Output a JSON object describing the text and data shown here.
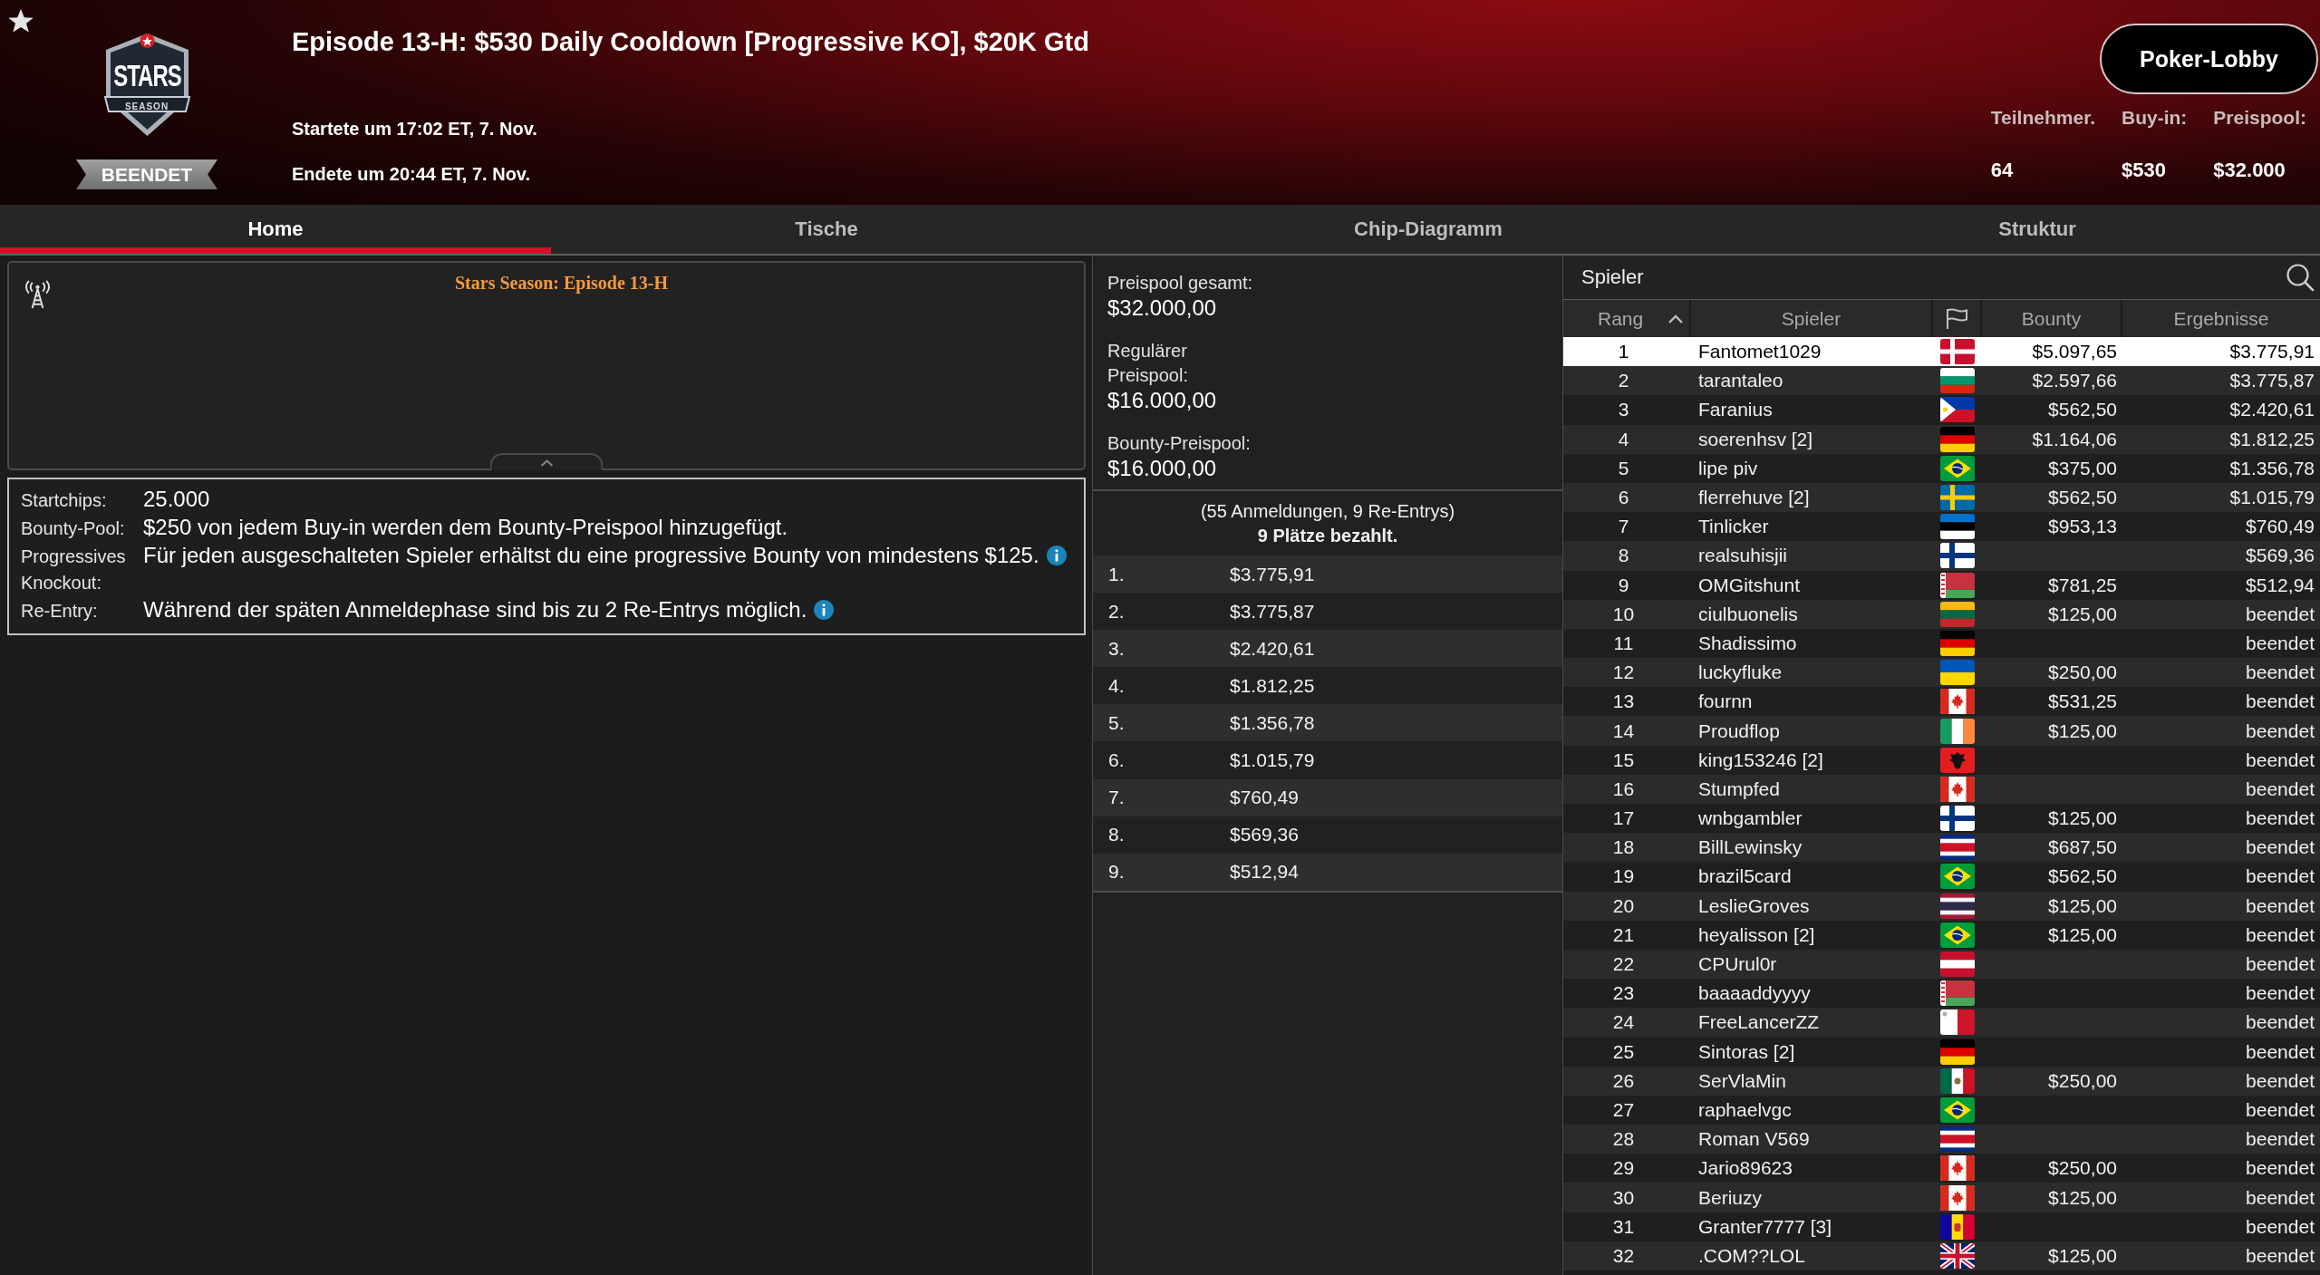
{
  "header": {
    "logo": {
      "title": "STARS",
      "subtitle": "SEASON"
    },
    "status": "BEENDET",
    "title": "Episode 13-H: $530 Daily Cooldown [Progressive KO], $20K Gtd",
    "started": "Startete um 17:02 ET, 7. Nov.",
    "ended": "Endete um 20:44 ET, 7. Nov.",
    "lobby_button": "Poker-Lobby",
    "stats": [
      {
        "label": "Teilnehmer.",
        "value": "64"
      },
      {
        "label": "Buy-in:",
        "value": "$530"
      },
      {
        "label": "Preispool:",
        "value": "$32.000"
      }
    ]
  },
  "tabs": [
    {
      "label": "Home",
      "selected": true
    },
    {
      "label": "Tische",
      "selected": false
    },
    {
      "label": "Chip-Diagramm",
      "selected": false
    },
    {
      "label": "Struktur",
      "selected": false
    }
  ],
  "news": {
    "title": "Stars Season: Episode 13-H"
  },
  "details": [
    {
      "label": "Startchips:",
      "value": "25.000",
      "info": false
    },
    {
      "label": "Bounty-Pool:",
      "value": "$250 von jedem Buy-in werden dem Bounty-Preispool hinzugefügt.",
      "info": false
    },
    {
      "label": "Progressives Knockout:",
      "value": "Für jeden ausgeschalteten Spieler erhältst du eine progressive Bounty von mindestens $125.",
      "info": true
    },
    {
      "label": "Re-Entry:",
      "value": "Während der späten Anmeldephase sind bis zu 2 Re-Entrys möglich.",
      "info": true
    }
  ],
  "prize_pool": {
    "totals": [
      {
        "label": "Preispool gesamt:",
        "value": "$32.000,00"
      },
      {
        "label": "Regulärer Preispool:",
        "value": "$16.000,00"
      },
      {
        "label": "Bounty-Preispool:",
        "value": "$16.000,00"
      }
    ],
    "entries_note": "(55 Anmeldungen, 9 Re-Entrys)",
    "paid_note": "9 Plätze bezahlt.",
    "payouts": [
      {
        "place": "1.",
        "amount": "$3.775,91"
      },
      {
        "place": "2.",
        "amount": "$3.775,87"
      },
      {
        "place": "3.",
        "amount": "$2.420,61"
      },
      {
        "place": "4.",
        "amount": "$1.812,25"
      },
      {
        "place": "5.",
        "amount": "$1.356,78"
      },
      {
        "place": "6.",
        "amount": "$1.015,79"
      },
      {
        "place": "7.",
        "amount": "$760,49"
      },
      {
        "place": "8.",
        "amount": "$569,36"
      },
      {
        "place": "9.",
        "amount": "$512,94"
      }
    ]
  },
  "players": {
    "title": "Spieler",
    "columns": [
      {
        "kind": "text",
        "label": "Rang",
        "sorted": true
      },
      {
        "kind": "text",
        "label": "Spieler",
        "sorted": false
      },
      {
        "kind": "flag"
      },
      {
        "kind": "text",
        "label": "Bounty",
        "sorted": false
      },
      {
        "kind": "text",
        "label": "Ergebnisse",
        "sorted": false
      }
    ],
    "rows": [
      {
        "rank": "1",
        "name": "Fantomet1029",
        "flag": {
          "kind": "dk"
        },
        "bounty": "$5.097,65",
        "result": "$3.775,91",
        "selected": true
      },
      {
        "rank": "2",
        "name": "tarantaleo",
        "flag": {
          "kind": "bg"
        },
        "bounty": "$2.597,66",
        "result": "$3.775,87",
        "selected": false
      },
      {
        "rank": "3",
        "name": "Faranius",
        "flag": {
          "kind": "ph"
        },
        "bounty": "$562,50",
        "result": "$2.420,61",
        "selected": false
      },
      {
        "rank": "4",
        "name": "soerenhsv [2]",
        "flag": {
          "kind": "de"
        },
        "bounty": "$1.164,06",
        "result": "$1.812,25",
        "selected": false
      },
      {
        "rank": "5",
        "name": "lipe piv",
        "flag": {
          "kind": "br"
        },
        "bounty": "$375,00",
        "result": "$1.356,78",
        "selected": false
      },
      {
        "rank": "6",
        "name": "flerrehuve [2]",
        "flag": {
          "kind": "se"
        },
        "bounty": "$562,50",
        "result": "$1.015,79",
        "selected": false
      },
      {
        "rank": "7",
        "name": "Tinlicker",
        "flag": {
          "kind": "ee"
        },
        "bounty": "$953,13",
        "result": "$760,49",
        "selected": false
      },
      {
        "rank": "8",
        "name": "realsuhisjii",
        "flag": {
          "kind": "fi"
        },
        "result": "$569,36",
        "selected": false
      },
      {
        "rank": "9",
        "name": "OMGitshunt",
        "flag": {
          "kind": "by"
        },
        "bounty": "$781,25",
        "result": "$512,94",
        "selected": false
      },
      {
        "rank": "10",
        "name": "ciulbuonelis",
        "flag": {
          "kind": "lt"
        },
        "bounty": "$125,00",
        "result": "beendet",
        "selected": false
      },
      {
        "rank": "11",
        "name": "Shadissimo",
        "flag": {
          "kind": "de"
        },
        "result": "beendet",
        "selected": false
      },
      {
        "rank": "12",
        "name": "luckyfluke",
        "flag": {
          "kind": "ua"
        },
        "bounty": "$250,00",
        "result": "beendet",
        "selected": false
      },
      {
        "rank": "13",
        "name": "fournn",
        "flag": {
          "kind": "ca"
        },
        "bounty": "$531,25",
        "result": "beendet",
        "selected": false
      },
      {
        "rank": "14",
        "name": "Proudflop",
        "flag": {
          "kind": "ie"
        },
        "bounty": "$125,00",
        "result": "beendet",
        "selected": false
      },
      {
        "rank": "15",
        "name": "king153246 [2]",
        "flag": {
          "kind": "al"
        },
        "result": "beendet",
        "selected": false
      },
      {
        "rank": "16",
        "name": "Stumpfed",
        "flag": {
          "kind": "ca"
        },
        "result": "beendet",
        "selected": false
      },
      {
        "rank": "17",
        "name": "wnbgambler",
        "flag": {
          "kind": "fi"
        },
        "bounty": "$125,00",
        "result": "beendet",
        "selected": false
      },
      {
        "rank": "18",
        "name": "BillLewinsky",
        "flag": {
          "kind": "cr"
        },
        "bounty": "$687,50",
        "result": "beendet",
        "selected": false
      },
      {
        "rank": "19",
        "name": "brazil5card",
        "flag": {
          "kind": "br"
        },
        "bounty": "$562,50",
        "result": "beendet",
        "selected": false
      },
      {
        "rank": "20",
        "name": "LeslieGroves",
        "flag": {
          "kind": "th"
        },
        "bounty": "$125,00",
        "result": "beendet",
        "selected": false
      },
      {
        "rank": "21",
        "name": "heyalisson [2]",
        "flag": {
          "kind": "br"
        },
        "bounty": "$125,00",
        "result": "beendet",
        "selected": false
      },
      {
        "rank": "22",
        "name": "CPUrul0r",
        "flag": {
          "kind": "at"
        },
        "result": "beendet",
        "selected": false
      },
      {
        "rank": "23",
        "name": "baaaaddyyyy",
        "flag": {
          "kind": "by"
        },
        "result": "beendet",
        "selected": false
      },
      {
        "rank": "24",
        "name": "FreeLancerZZ",
        "flag": {
          "kind": "mt"
        },
        "result": "beendet",
        "selected": false
      },
      {
        "rank": "25",
        "name": "Sintoras [2]",
        "flag": {
          "kind": "de"
        },
        "result": "beendet",
        "selected": false
      },
      {
        "rank": "26",
        "name": "SerVlaMin",
        "flag": {
          "kind": "mx"
        },
        "bounty": "$250,00",
        "result": "beendet",
        "selected": false
      },
      {
        "rank": "27",
        "name": "raphaelvgc",
        "flag": {
          "kind": "br"
        },
        "result": "beendet",
        "selected": false
      },
      {
        "rank": "28",
        "name": "Roman V569",
        "flag": {
          "kind": "cr"
        },
        "result": "beendet",
        "selected": false
      },
      {
        "rank": "29",
        "name": "Jario89623",
        "flag": {
          "kind": "ca"
        },
        "bounty": "$250,00",
        "result": "beendet",
        "selected": false
      },
      {
        "rank": "30",
        "name": "Beriuzy",
        "flag": {
          "kind": "ca"
        },
        "bounty": "$125,00",
        "result": "beendet",
        "selected": false
      },
      {
        "rank": "31",
        "name": "Granter7777 [3]",
        "flag": {
          "kind": "ad"
        },
        "result": "beendet",
        "selected": false
      },
      {
        "rank": "32",
        "name": ".COM??LOL",
        "flag": {
          "kind": "gb"
        },
        "bounty": "$125,00",
        "result": "beendet",
        "selected": false
      }
    ]
  }
}
